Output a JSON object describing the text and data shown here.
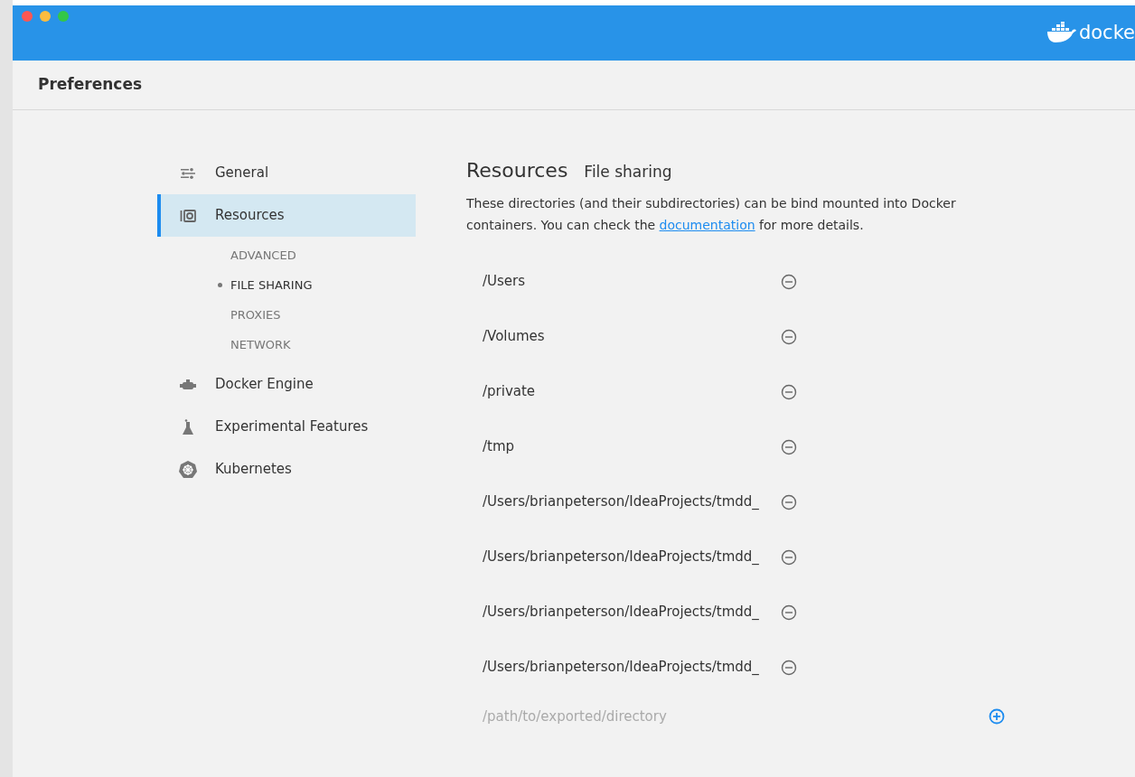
{
  "window": {
    "logo_text": "docke"
  },
  "header": {
    "title": "Preferences"
  },
  "sidebar": {
    "items": [
      {
        "label": "General",
        "selected": false
      },
      {
        "label": "Resources",
        "selected": true,
        "children": [
          {
            "label": "ADVANCED",
            "selected": false
          },
          {
            "label": "FILE SHARING",
            "selected": true
          },
          {
            "label": "PROXIES",
            "selected": false
          },
          {
            "label": "NETWORK",
            "selected": false
          }
        ]
      },
      {
        "label": "Docker Engine",
        "selected": false
      },
      {
        "label": "Experimental Features",
        "selected": false
      },
      {
        "label": "Kubernetes",
        "selected": false
      }
    ]
  },
  "content": {
    "title": "Resources",
    "subtitle": "File sharing",
    "description_before": "These directories (and their subdirectories) can be bind mounted into Docker containers. You can check the",
    "link": "documentation",
    "description_after": "for more details.",
    "directories": [
      "/Users",
      "/Volumes",
      "/private",
      "/tmp",
      "/Users/brianpeterson/IdeaProjects/tmdd_",
      "/Users/brianpeterson/IdeaProjects/tmdd_",
      "/Users/brianpeterson/IdeaProjects/tmdd_",
      "/Users/brianpeterson/IdeaProjects/tmdd_"
    ],
    "new_directory": {
      "placeholder": "/path/to/exported/directory"
    }
  }
}
